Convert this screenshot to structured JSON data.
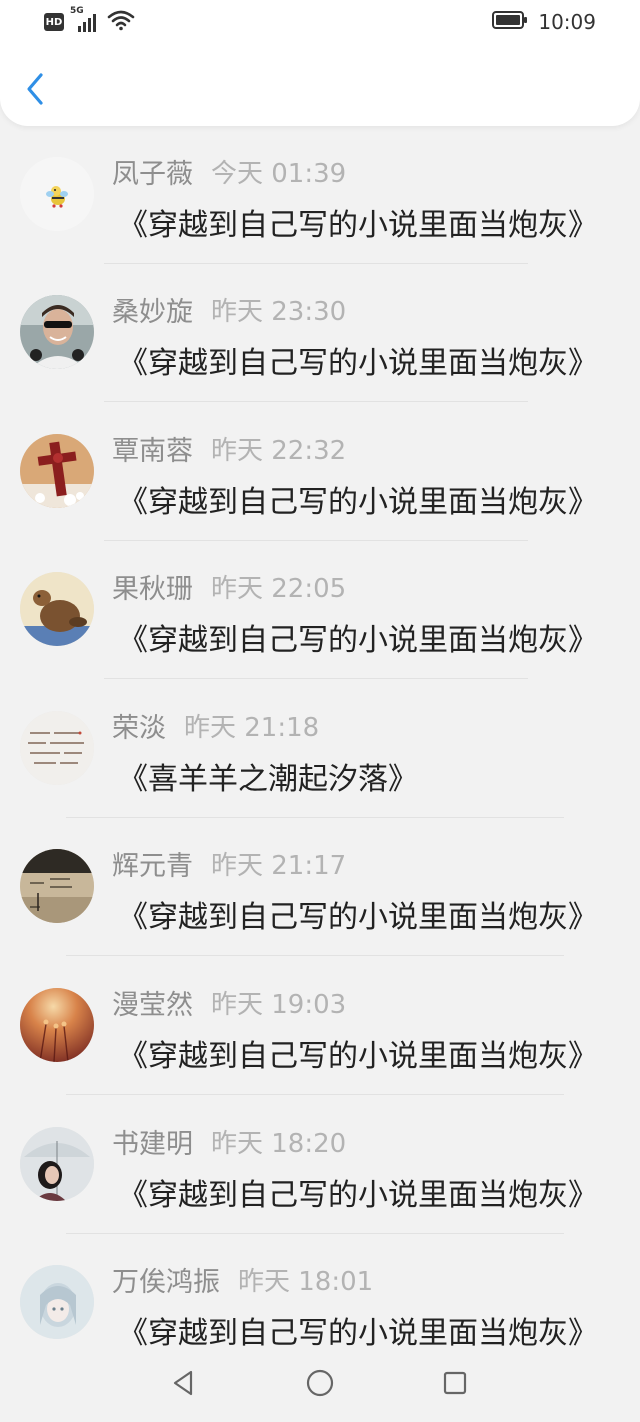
{
  "status_bar": {
    "hd_badge": "HD",
    "network": "5G",
    "time": "10:09"
  },
  "header": {
    "back_icon": "chevron-left-icon",
    "accent_color": "#2f8fe6"
  },
  "items": [
    {
      "name": "凤子薇",
      "time": "今天 01:39",
      "title": "《穿越到自己写的小说里面当炮灰》",
      "avatar": "cartoon-bee"
    },
    {
      "name": "桑妙旋",
      "time": "昨天 23:30",
      "title": "《穿越到自己写的小说里面当炮灰》",
      "avatar": "man-sunglasses"
    },
    {
      "name": "覃南蓉",
      "time": "昨天 22:32",
      "title": "《穿越到自己写的小说里面当炮灰》",
      "avatar": "red-cross"
    },
    {
      "name": "果秋珊",
      "time": "昨天 22:05",
      "title": "《穿越到自己写的小说里面当炮灰》",
      "avatar": "beaver"
    },
    {
      "name": "荣淡",
      "time": "昨天 21:18",
      "title": "《喜羊羊之潮起汐落》",
      "avatar": "handwriting"
    },
    {
      "name": "辉元青",
      "time": "昨天 21:17",
      "title": "《穿越到自己写的小说里面当炮灰》",
      "avatar": "vintage-text"
    },
    {
      "name": "漫莹然",
      "time": "昨天 19:03",
      "title": "《穿越到自己写的小说里面当炮灰》",
      "avatar": "warm-bokeh"
    },
    {
      "name": "书建明",
      "time": "昨天 18:20",
      "title": "《穿越到自己写的小说里面当炮灰》",
      "avatar": "girl-umbrella"
    },
    {
      "name": "万俟鸿振",
      "time": "昨天 18:01",
      "title": "《穿越到自己写的小说里面当炮灰》",
      "avatar": "anime-girl"
    }
  ],
  "navbar": {
    "back": "triangle-back-icon",
    "home": "circle-home-icon",
    "recents": "square-recents-icon"
  }
}
